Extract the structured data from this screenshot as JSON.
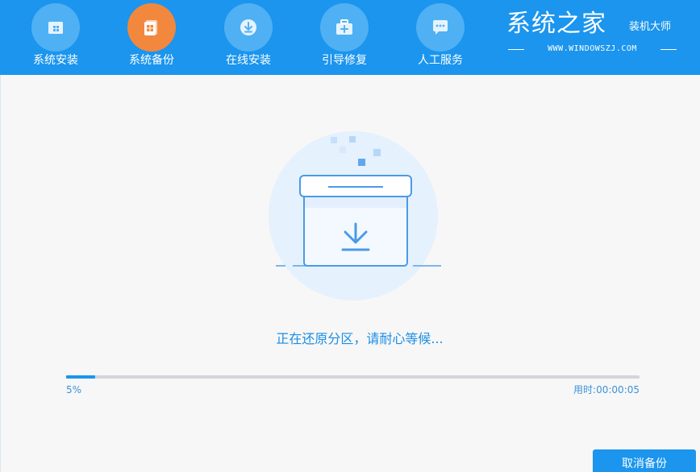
{
  "nav": {
    "items": [
      {
        "label": "系统安装",
        "icon": "windows-box-icon",
        "active": false
      },
      {
        "label": "系统备份",
        "icon": "windows-backup-icon",
        "active": true
      },
      {
        "label": "在线安装",
        "icon": "download-icon",
        "active": false
      },
      {
        "label": "引导修复",
        "icon": "toolbox-icon",
        "active": false
      },
      {
        "label": "人工服务",
        "icon": "chat-icon",
        "active": false
      }
    ]
  },
  "brand": {
    "title": "系统之家",
    "subtitle": "装机大师",
    "url": "WWW.WINDOWSZJ.COM"
  },
  "main": {
    "status_text": "正在还原分区，请耐心等候...",
    "progress_fraction": 0.05,
    "progress_label": "5%",
    "elapsed_label": "用时:00:00:05",
    "cancel_label": "取消备份"
  },
  "colors": {
    "accent": "#1b95ee",
    "active_nav": "#f2883d",
    "background": "#f7f7f7"
  }
}
